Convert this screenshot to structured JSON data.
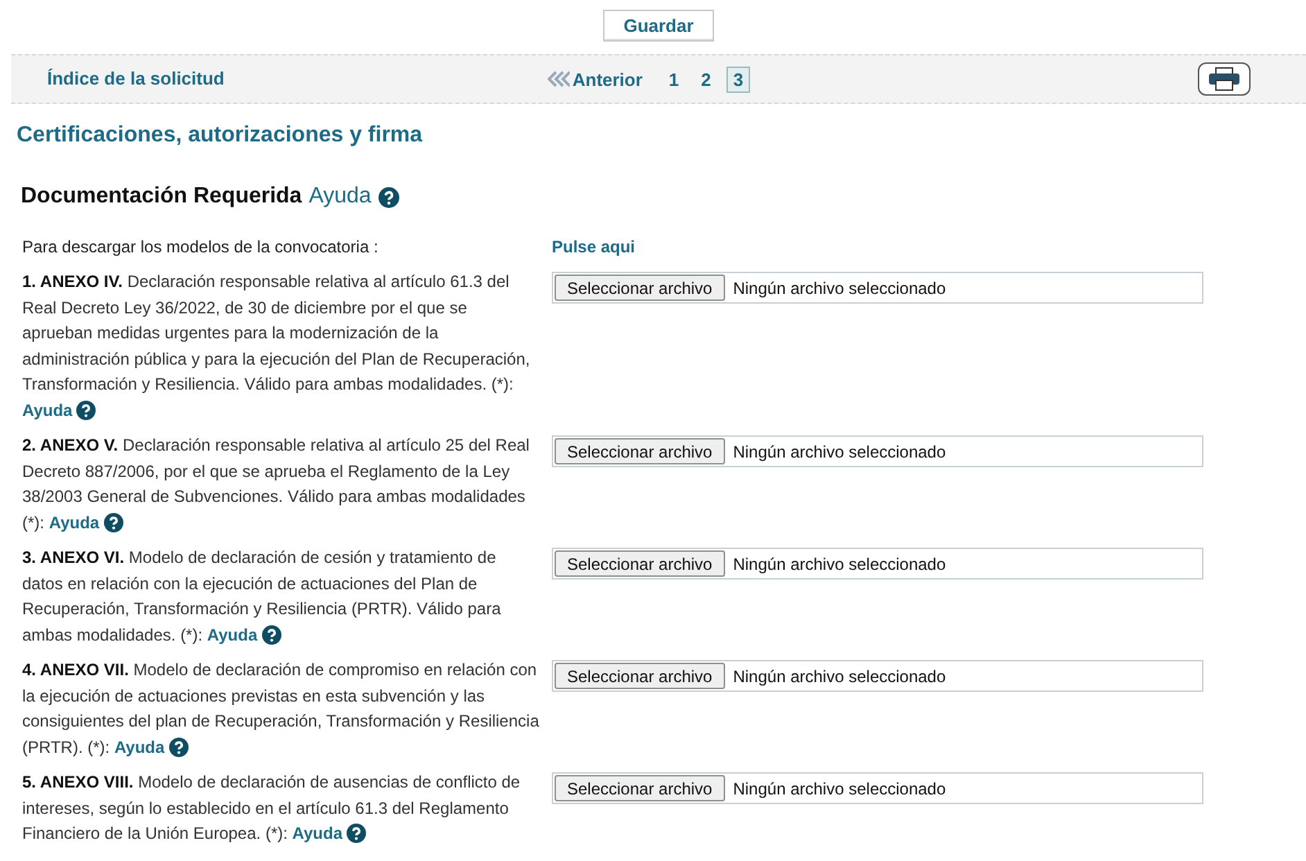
{
  "save_button": "Guardar",
  "nav": {
    "index_link": "Índice de la solicitud",
    "previous_link": "Anterior",
    "pages": [
      {
        "label": "1",
        "selected": false
      },
      {
        "label": "2",
        "selected": false
      },
      {
        "label": "3",
        "selected": true
      }
    ]
  },
  "section_title": "Certificaciones, autorizaciones y firma",
  "docs_heading": {
    "title": "Documentación Requerida",
    "help_link": "Ayuda"
  },
  "download": {
    "label": "Para descargar los modelos de la convocatoria :",
    "link": "Pulse aqui"
  },
  "documents": [
    {
      "text": "**1. ANEXO IV.** Declaración responsable relativa al artículo 61.3 del Real Decreto Ley 36/2022, de 30 de diciembre por el que se aprueban medidas urgentes para la modernización de la administración pública y para la ejecución del Plan de Recuperación, Transformación y Resiliencia. Válido para ambas modalidades. (*):",
      "help_link": "Ayuda",
      "file_button": "Seleccionar archivo",
      "file_status": "Ningún archivo seleccionado"
    },
    {
      "text": "**2. ANEXO V.** Declaración responsable relativa al artículo 25 del Real Decreto 887/2006, por el que se aprueba el Reglamento de la Ley 38/2003 General de Subvenciones. Válido para ambas modalidades (*):",
      "help_link": "Ayuda",
      "file_button": "Seleccionar archivo",
      "file_status": "Ningún archivo seleccionado"
    },
    {
      "text": "**3. ANEXO VI.** Modelo de declaración de cesión y tratamiento de datos en relación con la ejecución de actuaciones del Plan de Recuperación, Transformación y Resiliencia (PRTR). Válido para ambas modalidades. (*):",
      "help_link": "Ayuda",
      "file_button": "Seleccionar archivo",
      "file_status": "Ningún archivo seleccionado"
    },
    {
      "text": "**4. ANEXO VII.** Modelo de declaración de compromiso en relación con la ejecución de actuaciones previstas en esta subvención y las consiguientes del plan de Recuperación, Transformación y Resiliencia (PRTR). (*):",
      "help_link": "Ayuda",
      "file_button": "Seleccionar archivo",
      "file_status": "Ningún archivo seleccionado"
    },
    {
      "text": "**5. ANEXO VIII.** Modelo de declaración de ausencias de conflicto de intereses, según lo establecido en el artículo 61.3 del Reglamento Financiero de la Unión Europea. (*):",
      "help_link": "Ayuda",
      "file_button": "Seleccionar archivo",
      "file_status": "Ningún archivo seleccionado"
    }
  ]
}
